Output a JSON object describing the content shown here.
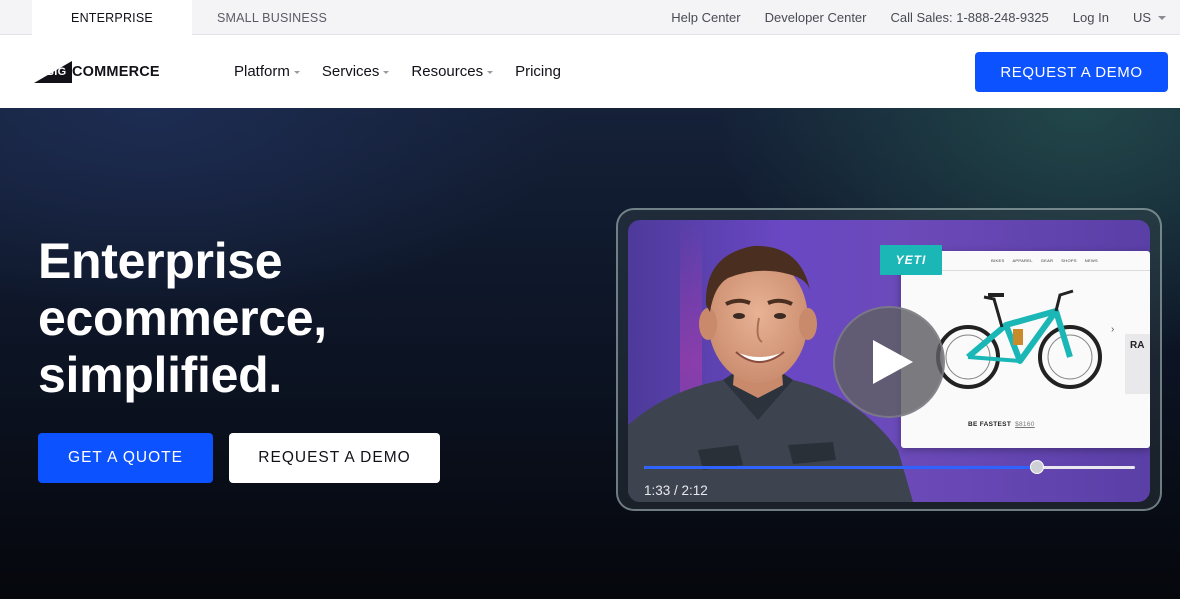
{
  "utility_bar": {
    "tabs": [
      {
        "label": "ENTERPRISE",
        "active": true
      },
      {
        "label": "SMALL BUSINESS",
        "active": false
      }
    ],
    "links": [
      "Help Center",
      "Developer Center",
      "Call Sales: 1-888-248-9325",
      "Log In"
    ],
    "locale": "US"
  },
  "nav": {
    "logo_prefix": "BIG",
    "logo_word": "COMMERCE",
    "items": [
      {
        "label": "Platform",
        "has_dropdown": true
      },
      {
        "label": "Services",
        "has_dropdown": true
      },
      {
        "label": "Resources",
        "has_dropdown": true
      },
      {
        "label": "Pricing",
        "has_dropdown": false
      }
    ],
    "cta": "REQUEST A DEMO"
  },
  "hero": {
    "headline": [
      "Enterprise",
      "ecommerce,",
      "simplified."
    ],
    "primary_cta": "GET A QUOTE",
    "secondary_cta": "REQUEST A DEMO"
  },
  "video": {
    "current_time": "1:33",
    "duration": "2:12",
    "time_display": "1:33 / 2:12",
    "progress": 0.8,
    "embedded_site": {
      "brand": "YETI",
      "nav": [
        "BIKES",
        "APPAREL",
        "GEAR",
        "SHOPS",
        "NEWS"
      ],
      "tagline": "BE FASTEST",
      "price": "$8160",
      "side_tile": "RA"
    }
  },
  "colors": {
    "accent": "#0d52ff",
    "hero_bg": "#0d1526",
    "yeti_teal": "#1bb6b6"
  }
}
